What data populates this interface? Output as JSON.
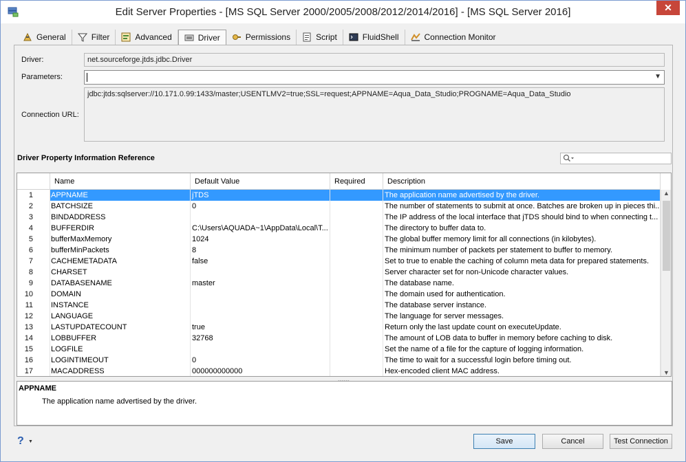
{
  "window": {
    "title": "Edit Server Properties - [MS SQL Server 2000/2005/2008/2012/2014/2016] - [MS SQL Server 2016]",
    "close_label": "✕"
  },
  "tabs": [
    {
      "label": "General",
      "icon": "general-icon"
    },
    {
      "label": "Filter",
      "icon": "filter-icon"
    },
    {
      "label": "Advanced",
      "icon": "advanced-icon"
    },
    {
      "label": "Driver",
      "icon": "driver-icon",
      "active": true
    },
    {
      "label": "Permissions",
      "icon": "permissions-icon"
    },
    {
      "label": "Script",
      "icon": "script-icon"
    },
    {
      "label": "FluidShell",
      "icon": "fluidshell-icon"
    },
    {
      "label": "Connection Monitor",
      "icon": "connection-monitor-icon"
    }
  ],
  "driver_form": {
    "driver_label": "Driver:",
    "driver_value": "net.sourceforge.jtds.jdbc.Driver",
    "parameters_label": "Parameters:",
    "parameters_value": "",
    "connection_url_label": "Connection URL:",
    "connection_url_value": "jdbc:jtds:sqlserver://10.171.0.99:1433/master;USENTLMV2=true;SSL=request;APPNAME=Aqua_Data_Studio;PROGNAME=Aqua_Data_Studio"
  },
  "reference": {
    "title": "Driver Property Information Reference",
    "search_placeholder": ""
  },
  "table": {
    "columns": [
      "Name",
      "Default Value",
      "Required",
      "Description"
    ],
    "selected_row": 1,
    "rows": [
      {
        "num": "1",
        "name": "APPNAME",
        "default": "jTDS",
        "required": "",
        "desc": "The application name advertised by the driver."
      },
      {
        "num": "2",
        "name": "BATCHSIZE",
        "default": "0",
        "required": "",
        "desc": "The number of statements to submit at once. Batches are broken up in pieces thi..."
      },
      {
        "num": "3",
        "name": "BINDADDRESS",
        "default": "",
        "required": "",
        "desc": "The IP address of the local interface that jTDS should bind to when connecting t..."
      },
      {
        "num": "4",
        "name": "BUFFERDIR",
        "default": "C:\\Users\\AQUADA~1\\AppData\\Local\\T...",
        "required": "",
        "desc": "The directory to buffer data to."
      },
      {
        "num": "5",
        "name": "bufferMaxMemory",
        "default": "1024",
        "required": "",
        "desc": "The global buffer memory limit for all connections (in kilobytes)."
      },
      {
        "num": "6",
        "name": "bufferMinPackets",
        "default": "8",
        "required": "",
        "desc": "The minimum number of packets per statement to buffer to memory."
      },
      {
        "num": "7",
        "name": "CACHEMETADATA",
        "default": "false",
        "required": "",
        "desc": "Set to true to enable the caching of column meta data for prepared statements."
      },
      {
        "num": "8",
        "name": "CHARSET",
        "default": "",
        "required": "",
        "desc": "Server character set for non-Unicode character values."
      },
      {
        "num": "9",
        "name": "DATABASENAME",
        "default": "master",
        "required": "",
        "desc": "The database name."
      },
      {
        "num": "10",
        "name": "DOMAIN",
        "default": "",
        "required": "",
        "desc": "The domain used for authentication."
      },
      {
        "num": "11",
        "name": "INSTANCE",
        "default": "",
        "required": "",
        "desc": "The database server instance."
      },
      {
        "num": "12",
        "name": "LANGUAGE",
        "default": "",
        "required": "",
        "desc": "The language for server messages."
      },
      {
        "num": "13",
        "name": "LASTUPDATECOUNT",
        "default": "true",
        "required": "",
        "desc": "Return only the last update count on executeUpdate."
      },
      {
        "num": "14",
        "name": "LOBBUFFER",
        "default": "32768",
        "required": "",
        "desc": "The amount of LOB data to buffer in memory before caching to disk."
      },
      {
        "num": "15",
        "name": "LOGFILE",
        "default": "",
        "required": "",
        "desc": "Set the name of a file for the capture of logging information."
      },
      {
        "num": "16",
        "name": "LOGINTIMEOUT",
        "default": "0",
        "required": "",
        "desc": "The time to wait for a successful login before timing out."
      },
      {
        "num": "17",
        "name": "MACADDRESS",
        "default": "000000000000",
        "required": "",
        "desc": "Hex-encoded client MAC address."
      }
    ]
  },
  "info": {
    "title": "APPNAME",
    "desc": "The application name advertised by the driver."
  },
  "footer": {
    "help_label": "?",
    "save_label": "Save",
    "cancel_label": "Cancel",
    "test_label": "Test Connection"
  },
  "colors": {
    "selection": "#3399ff",
    "close_button": "#c7463a"
  }
}
